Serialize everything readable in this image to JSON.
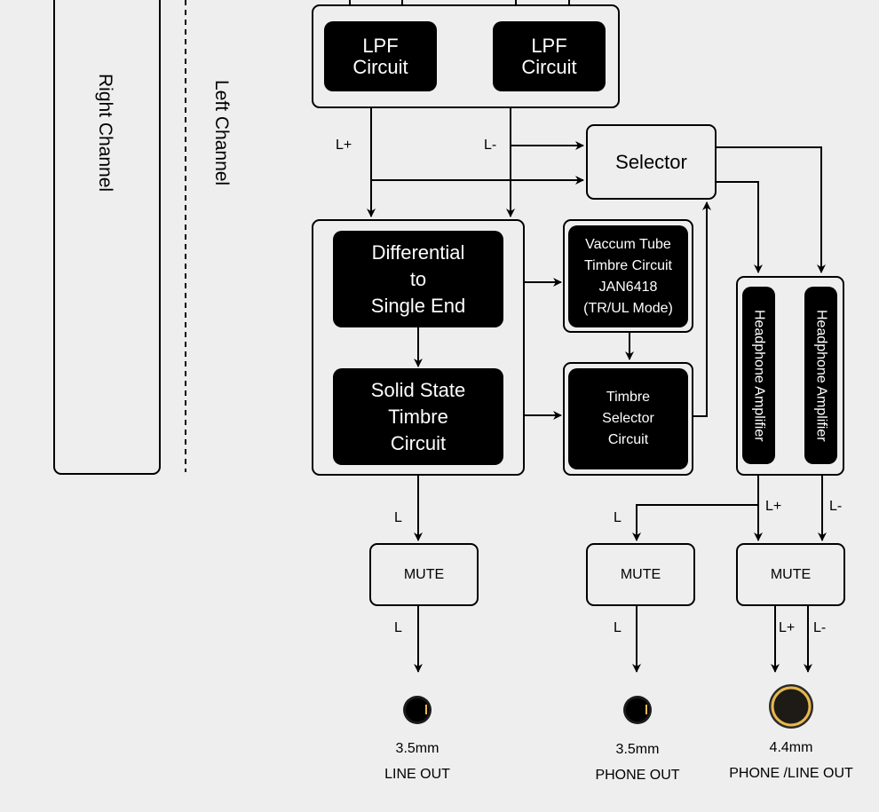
{
  "diagram": {
    "channels": {
      "right": "Right Channel",
      "left": "Left Channel"
    },
    "blocks": {
      "lpf_1": "LPF\nCircuit",
      "lpf_2": "LPF\nCircuit",
      "selector": "Selector",
      "diff_to_se": "Differential\nto\nSingle End",
      "solid_state": "Solid State\nTimbre\nCircuit",
      "vacuum_tube": "Vaccum Tube\nTimbre Circuit\nJAN6418\n(TR/UL Mode)",
      "timbre_selector": "Timbre\nSelector\nCircuit",
      "hp_amp_1": "Headphone Amplifier",
      "hp_amp_2": "Headphone Amplifier",
      "mute_1": "MUTE",
      "mute_2": "MUTE",
      "mute_3": "MUTE"
    },
    "signal_labels": {
      "lpf_l_plus": "L+",
      "lpf_l_minus": "L-",
      "line_in": "L",
      "line_out": "L",
      "phone_in": "L",
      "phone_out": "L",
      "amp_l_plus": "L+",
      "amp_l_minus": "L-",
      "bal_out_plus": "L+",
      "bal_out_minus": "L-"
    },
    "outputs": [
      {
        "size": "3.5mm",
        "name": "LINE OUT",
        "icon": "jack-3.5mm-icon"
      },
      {
        "size": "3.5mm",
        "name": "PHONE OUT",
        "icon": "jack-3.5mm-icon"
      },
      {
        "size": "4.4mm",
        "name": "PHONE /LINE OUT",
        "icon": "jack-4.4mm-icon"
      }
    ],
    "colors": {
      "background": "#eeeeee",
      "line": "#000000",
      "block": "#000000",
      "block_text": "#ffffff",
      "jack_ring": "#e8b84a"
    }
  }
}
